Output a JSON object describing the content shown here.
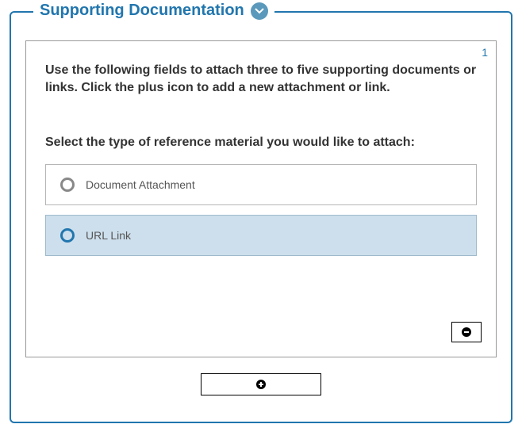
{
  "section": {
    "title": "Supporting Documentation"
  },
  "item": {
    "number": "1",
    "instructions": "Use the following fields to attach three to five supporting documents or links. Click the plus icon to add a new attachment or link.",
    "prompt": "Select the type of reference material you would like to attach:",
    "options": [
      {
        "label": "Document Attachment"
      },
      {
        "label": "URL Link"
      }
    ]
  }
}
